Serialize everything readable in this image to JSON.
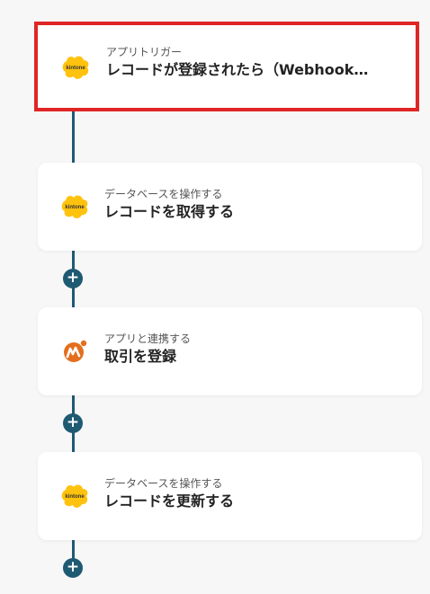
{
  "steps": [
    {
      "category": "アプリトリガー",
      "title": "レコードが登録されたら（Webhook…",
      "icon": "kintone-icon",
      "icon_label": "kintone"
    },
    {
      "category": "データベースを操作する",
      "title": "レコードを取得する",
      "icon": "kintone-icon",
      "icon_label": "kintone"
    },
    {
      "category": "アプリと連携する",
      "title": "取引を登録",
      "icon": "moneyforward-icon"
    },
    {
      "category": "データベースを操作する",
      "title": "レコードを更新する",
      "icon": "kintone-icon",
      "icon_label": "kintone"
    }
  ],
  "add_label": "+",
  "colors": {
    "connector": "#1f5a73",
    "selected_border": "#e02525",
    "kintone": "#ffc20e",
    "moneyforward": "#e36f1e"
  }
}
